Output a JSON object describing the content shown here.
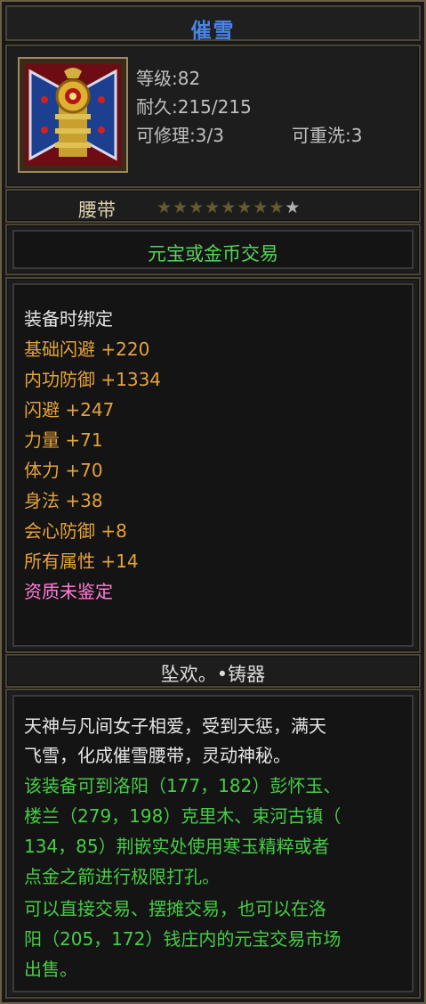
{
  "item": {
    "name": "催雪",
    "level_label": "等级:82",
    "durability_label": "耐久:215/215",
    "repair_label": "可修理:3/3",
    "reroll_label": "可重洗:3",
    "type_label": "腰带",
    "stars_filled": 8,
    "stars_total": 9,
    "icon": "belt-icon"
  },
  "trade": {
    "text": "元宝或金币交易"
  },
  "attributes": {
    "bind": "装备时绑定",
    "list": [
      "基础闪避 +220",
      "内功防御 +1334",
      "闪避 +247",
      "力量 +71",
      "体力 +70",
      "身法 +38",
      "会心防御 +8",
      "所有属性 +14"
    ],
    "quality": "资质未鉴定"
  },
  "maker": {
    "text": "坠欢。•铸器"
  },
  "description": {
    "lore_lines": [
      "天神与凡间女子相爱，受到天惩，满天",
      "飞雪，化成催雪腰带，灵动神秘。"
    ],
    "punch_lines": [
      "该装备可到洛阳（177，182）彭怀玉、",
      "楼兰（279，198）克里木、束河古镇（",
      "134，85）荆嵌实处使用寒玉精粹或者",
      "点金之箭进行极限打孔。"
    ],
    "trade_lines": [
      "可以直接交易、摆摊交易，也可以在洛",
      "阳（205，172）钱庄内的元宝交易市场",
      "出售。"
    ]
  },
  "colors": {
    "title": "#4b84e6",
    "green": "#47cc47",
    "orange": "#e5a23c",
    "pink": "#ff7dd8"
  }
}
